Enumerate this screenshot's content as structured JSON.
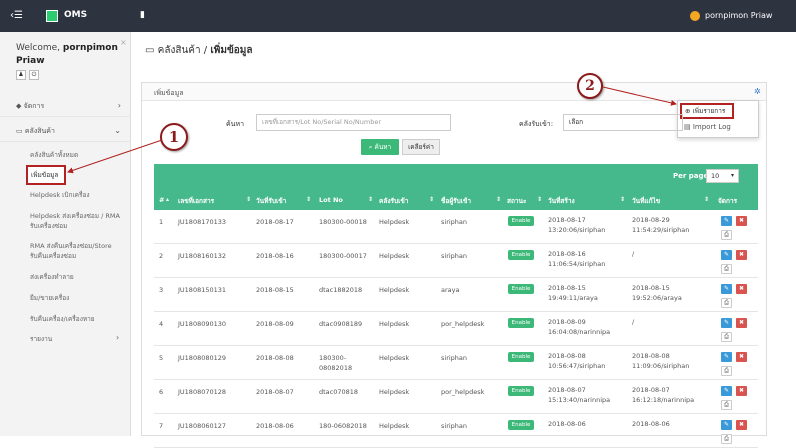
{
  "topbar": {
    "app_name": "OMS",
    "user_name": "pornpimon Priaw"
  },
  "sidebar": {
    "welcome_prefix": "Welcome,",
    "welcome_name": "pornpimon Priaw",
    "items": [
      {
        "label": "จัดการ"
      },
      {
        "label": "คลังสินค้า"
      }
    ],
    "sub_items": [
      {
        "label": "คลังสินค้าทั้งหมด"
      },
      {
        "label": "เพิ่มข้อมูล"
      },
      {
        "label": "Helpdesk เบิกเครื่อง"
      },
      {
        "label": "Helpdesk ส่งเครื่องซ่อม / RMA รับเครื่องซ่อม"
      },
      {
        "label": "RMA ส่งคืนเครื่องซ่อม/Store รับคืนเครื่องซ่อม"
      },
      {
        "label": "ส่งเครื่องทำลาย"
      },
      {
        "label": "ยืม/ขายเครื่อง"
      },
      {
        "label": "รับคืนเครื่อง/เครื่องหาย"
      },
      {
        "label": "รายงาน"
      }
    ]
  },
  "breadcrumb": {
    "parent": "คลังสินค้า",
    "sep": "/",
    "current": "เพิ่มข้อมูล"
  },
  "panel": {
    "title": "เพิ่มข้อมูล"
  },
  "dropdown": {
    "add_label": "เพิ่มรายการ",
    "import_label": "Import Log"
  },
  "search": {
    "label": "ค้นหา",
    "placeholder": "เลขที่เอกสาร/Lot No/Serial No/Number",
    "warehouse_label": "คลังรับเข้า:",
    "warehouse_value": "เลือก",
    "search_button": "ค้นหา",
    "clear_button": "เคลียร์ค่า"
  },
  "table": {
    "per_page_label": "Per page:",
    "per_page_value": "10",
    "columns": [
      "#",
      "เลขที่เอกสาร",
      "วันที่รับเข้า",
      "Lot No",
      "คลังรับเข้า",
      "ชื่อผู้รับเข้า",
      "สถานะ",
      "วันที่สร้าง",
      "วันที่แก้ไข",
      "จัดการ"
    ],
    "rows": [
      {
        "no": "1",
        "doc": "JU1808170133",
        "date": "2018-08-17",
        "lot1": "180300-00018",
        "lot2": "",
        "wh": "Helpdesk",
        "by": "siriphan",
        "status": "Enable",
        "created1": "2018-08-17",
        "created2": "13:20:06/siriphan",
        "updated1": "2018-08-29",
        "updated2": "11:54:29/siriphan"
      },
      {
        "no": "2",
        "doc": "JU1808160132",
        "date": "2018-08-16",
        "lot1": "180300-00017",
        "lot2": "",
        "wh": "Helpdesk",
        "by": "siriphan",
        "status": "Enable",
        "created1": "2018-08-16",
        "created2": "11:06:54/siriphan",
        "updated1": "/",
        "updated2": ""
      },
      {
        "no": "3",
        "doc": "JU1808150131",
        "date": "2018-08-15",
        "lot1": "dtac1882018",
        "lot2": "",
        "wh": "Helpdesk",
        "by": "araya",
        "status": "Enable",
        "created1": "2018-08-15",
        "created2": "19:49:11/araya",
        "updated1": "2018-08-15",
        "updated2": "19:52:06/araya"
      },
      {
        "no": "4",
        "doc": "JU1808090130",
        "date": "2018-08-09",
        "lot1": "dtac0908189",
        "lot2": "",
        "wh": "Helpdesk",
        "by": "por_helpdesk",
        "status": "Enable",
        "created1": "2018-08-09",
        "created2": "16:04:08/narinnipa",
        "updated1": "/",
        "updated2": ""
      },
      {
        "no": "5",
        "doc": "JU1808080129",
        "date": "2018-08-08",
        "lot1": "180300-",
        "lot2": "08082018",
        "wh": "Helpdesk",
        "by": "siriphan",
        "status": "Enable",
        "created1": "2018-08-08",
        "created2": "10:56:47/siriphan",
        "updated1": "2018-08-08",
        "updated2": "11:09:06/siriphan"
      },
      {
        "no": "6",
        "doc": "JU1808070128",
        "date": "2018-08-07",
        "lot1": "dtac070818",
        "lot2": "",
        "wh": "Helpdesk",
        "by": "por_helpdesk",
        "status": "Enable",
        "created1": "2018-08-07",
        "created2": "15:13:40/narinnipa",
        "updated1": "2018-08-07",
        "updated2": "16:12:18/narinnipa"
      },
      {
        "no": "7",
        "doc": "JU1808060127",
        "date": "2018-08-06",
        "lot1": "180-06082018",
        "lot2": "",
        "wh": "Helpdesk",
        "by": "siriphan",
        "status": "Enable",
        "created1": "2018-08-06",
        "created2": "",
        "updated1": "2018-08-06",
        "updated2": ""
      }
    ]
  },
  "callouts": [
    "1",
    "2"
  ]
}
